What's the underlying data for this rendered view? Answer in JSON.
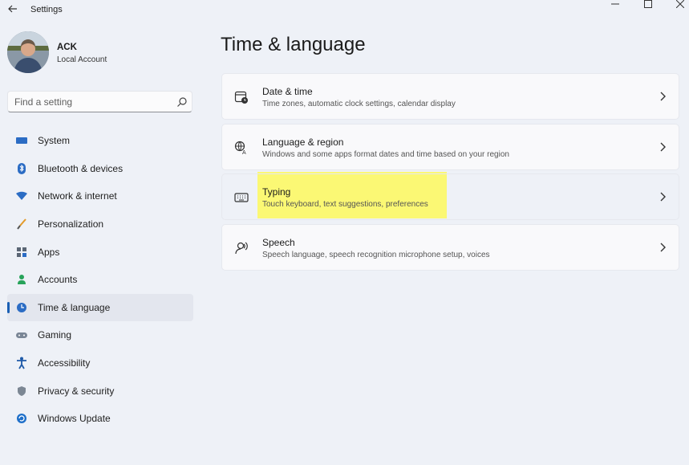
{
  "titlebar": {
    "title": "Settings",
    "back_icon": "arrow-left-icon",
    "minimize_icon": "minimize-icon",
    "maximize_icon": "maximize-icon",
    "close_icon": "close-icon"
  },
  "user": {
    "name": "ACK",
    "account_type": "Local Account"
  },
  "search": {
    "placeholder": "Find a setting",
    "icon": "search-icon"
  },
  "sidebar": {
    "items": [
      {
        "label": "System",
        "icon": "system-icon",
        "selected": false
      },
      {
        "label": "Bluetooth & devices",
        "icon": "bluetooth-icon",
        "selected": false
      },
      {
        "label": "Network & internet",
        "icon": "wifi-icon",
        "selected": false
      },
      {
        "label": "Personalization",
        "icon": "brush-icon",
        "selected": false
      },
      {
        "label": "Apps",
        "icon": "apps-icon",
        "selected": false
      },
      {
        "label": "Accounts",
        "icon": "person-icon",
        "selected": false
      },
      {
        "label": "Time & language",
        "icon": "globe-clock-icon",
        "selected": true
      },
      {
        "label": "Gaming",
        "icon": "gamepad-icon",
        "selected": false
      },
      {
        "label": "Accessibility",
        "icon": "accessibility-icon",
        "selected": false
      },
      {
        "label": "Privacy & security",
        "icon": "shield-icon",
        "selected": false
      },
      {
        "label": "Windows Update",
        "icon": "update-icon",
        "selected": false
      }
    ]
  },
  "main": {
    "title": "Time & language",
    "cards": [
      {
        "title": "Date & time",
        "description": "Time zones, automatic clock settings, calendar display",
        "icon": "calendar-clock-icon"
      },
      {
        "title": "Language & region",
        "description": "Windows and some apps format dates and time based on your region",
        "icon": "language-icon"
      },
      {
        "title": "Typing",
        "description": "Touch keyboard, text suggestions, preferences",
        "icon": "keyboard-icon",
        "highlighted": true
      },
      {
        "title": "Speech",
        "description": "Speech language, speech recognition microphone setup, voices",
        "icon": "speech-icon"
      }
    ]
  },
  "colors": {
    "accent": "#1a5fb4",
    "background": "#eef1f7",
    "card": "#f9f9fb",
    "highlight": "#fbf86d"
  }
}
